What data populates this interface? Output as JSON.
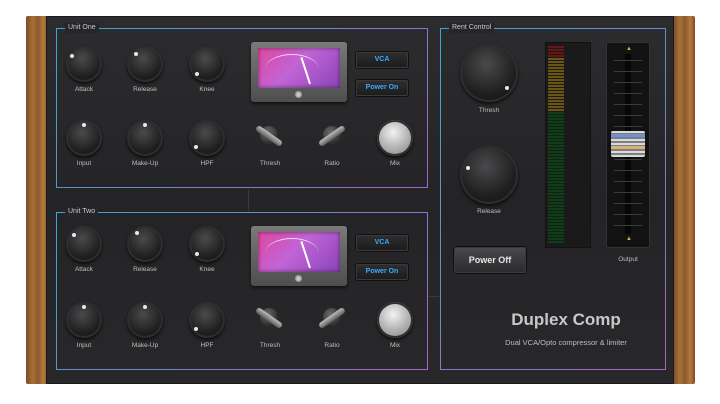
{
  "unit_one": {
    "title": "Unit One",
    "row1": [
      "Attack",
      "Release",
      "Knee"
    ],
    "row2": [
      "Input",
      "Make-Up",
      "HPF"
    ],
    "thresh": "Thresh",
    "ratio": "Ratio",
    "mix": "Mix",
    "vca": "VCA",
    "power": "Power On"
  },
  "unit_two": {
    "title": "Unit Two",
    "row1": [
      "Attack",
      "Release",
      "Knee"
    ],
    "row2": [
      "Input",
      "Make-Up",
      "HPF"
    ],
    "thresh": "Thresh",
    "ratio": "Ratio",
    "mix": "Mix",
    "vca": "VCA",
    "power": "Power On"
  },
  "rent_control": {
    "title": "Rent Control",
    "thresh": "Thresh",
    "release": "Release",
    "power": "Power Off",
    "output": "Output"
  },
  "brand": {
    "name": "Duplex Comp",
    "tagline": "Dual VCA/Opto compressor & limiter"
  },
  "colors": {
    "accent_blue": "#39a9ff",
    "panel_border_start": "#3aa6d8",
    "panel_border_end": "#a864c8",
    "meter_face": "#d04fb8",
    "wood": "#a8703a"
  }
}
